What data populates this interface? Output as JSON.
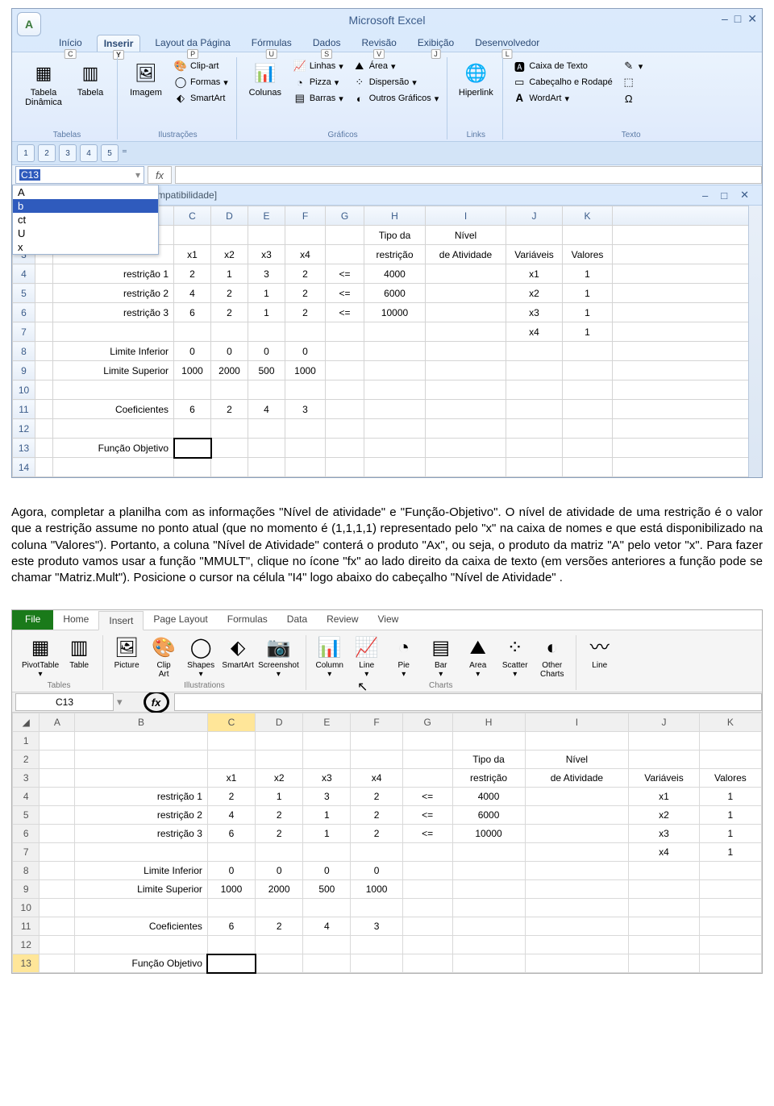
{
  "app": {
    "title": "Microsoft Excel"
  },
  "tabs1": {
    "inicio": "Início",
    "inserir": "Inserir",
    "layout": "Layout da Página",
    "formulas": "Fórmulas",
    "dados": "Dados",
    "revisao": "Revisão",
    "exibicao": "Exibição",
    "desenv": "Desenvolvedor",
    "keys": {
      "inicio": "C",
      "inserir": "Y",
      "layout": "P",
      "formulas": "U",
      "dados": "S",
      "revisao": "V",
      "exibicao": "J",
      "desenv": "L"
    }
  },
  "ribbon1": {
    "tabelas": {
      "label": "Tabelas",
      "dinamica": "Tabela\nDinâmica",
      "tabela": "Tabela"
    },
    "ilustr": {
      "label": "Ilustrações",
      "imagem": "Imagem",
      "clipart": "Clip-art",
      "formas": "Formas",
      "smartart": "SmartArt"
    },
    "graficos": {
      "label": "Gráficos",
      "colunas": "Colunas",
      "linhas": "Linhas",
      "area": "Área",
      "pizza": "Pizza",
      "dispersao": "Dispersão",
      "barras": "Barras",
      "outros": "Outros Gráficos"
    },
    "links": {
      "label": "Links",
      "hiperlink": "Hiperlink"
    },
    "texto": {
      "label": "Texto",
      "caixa": "Caixa de Texto",
      "cabec": "Cabeçalho e Rodapé",
      "wordart": "WordArt"
    }
  },
  "fx1": {
    "cell": "C13",
    "fx": "fx"
  },
  "dropdown": {
    "items": [
      "A",
      "b",
      "ct",
      "U",
      "x"
    ],
    "hl_index": 1
  },
  "doc": {
    "caption": "[ompatibilidade]"
  },
  "grid1": {
    "cols": [
      "",
      "",
      "C",
      "D",
      "E",
      "F",
      "G",
      "H",
      "I",
      "J",
      "K"
    ],
    "h2": {
      "H": "Tipo da",
      "I": "Nível"
    },
    "h3": {
      "C": "x1",
      "D": "x2",
      "E": "x3",
      "F": "x4",
      "H": "restrição",
      "I": "de Atividade",
      "J": "Variáveis",
      "K": "Valores"
    },
    "rows": [
      {
        "n": 4,
        "B": "restrição 1",
        "C": "2",
        "D": "1",
        "E": "3",
        "F": "2",
        "G": "<=",
        "H": "4000",
        "J": "x1",
        "K": "1"
      },
      {
        "n": 5,
        "B": "restrição 2",
        "C": "4",
        "D": "2",
        "E": "1",
        "F": "2",
        "G": "<=",
        "H": "6000",
        "J": "x2",
        "K": "1"
      },
      {
        "n": 6,
        "B": "restrição 3",
        "C": "6",
        "D": "2",
        "E": "1",
        "F": "2",
        "G": "<=",
        "H": "10000",
        "J": "x3",
        "K": "1"
      },
      {
        "n": 7,
        "J": "x4",
        "K": "1"
      },
      {
        "n": 8,
        "B": "Limite Inferior",
        "C": "0",
        "D": "0",
        "E": "0",
        "F": "0"
      },
      {
        "n": 9,
        "B": "Limite Superior",
        "C": "1000",
        "D": "2000",
        "E": "500",
        "F": "1000"
      },
      {
        "n": 10
      },
      {
        "n": 11,
        "B": "Coeficientes",
        "C": "6",
        "D": "2",
        "E": "4",
        "F": "3"
      },
      {
        "n": 12
      },
      {
        "n": 13,
        "B": "Função Objetivo",
        "sel": "C"
      },
      {
        "n": 14
      }
    ]
  },
  "paragraph": "Agora, completar a planilha com as informações \"Nível de atividade\" e \"Função-Objetivo\". O nível de atividade de uma restrição é o valor que a restrição assume no ponto atual (que no momento é (1,1,1,1) representado pelo \"x\" na caixa de nomes e que está disponibilizado na coluna \"Valores\").  Portanto, a coluna \"Nível de Atividade\" conterá o produto \"Ax\", ou seja, o produto da matriz \"A\" pelo vetor \"x\". Para fazer este produto vamos usar a função \"MMULT\", clique no ícone \"fx\"  ao lado direito da  caixa de texto  (em versões anteriores a função pode se chamar \"Matriz.Mult\"). Posicione o cursor na célula \"I4\" logo abaixo do cabeçalho \"Nível de Atividade\" .",
  "tabs2": {
    "file": "File",
    "home": "Home",
    "insert": "Insert",
    "page": "Page Layout",
    "formulas": "Formulas",
    "data": "Data",
    "review": "Review",
    "view": "View"
  },
  "ribbon2": {
    "tables": {
      "label": "Tables",
      "pivot": "PivotTable",
      "table": "Table"
    },
    "illus": {
      "label": "Illustrations",
      "picture": "Picture",
      "clip": "Clip\nArt",
      "shapes": "Shapes",
      "smartart": "SmartArt",
      "screenshot": "Screenshot"
    },
    "charts": {
      "label": "Charts",
      "column": "Column",
      "line": "Line",
      "pie": "Pie",
      "bar": "Bar",
      "area": "Area",
      "scatter": "Scatter",
      "other": "Other\nCharts"
    },
    "line2": "Line"
  },
  "fx2": {
    "cell": "C13",
    "fx": "fx"
  },
  "grid2": {
    "cols": [
      "",
      "A",
      "B",
      "C",
      "D",
      "E",
      "F",
      "G",
      "H",
      "I",
      "J",
      "K"
    ]
  }
}
